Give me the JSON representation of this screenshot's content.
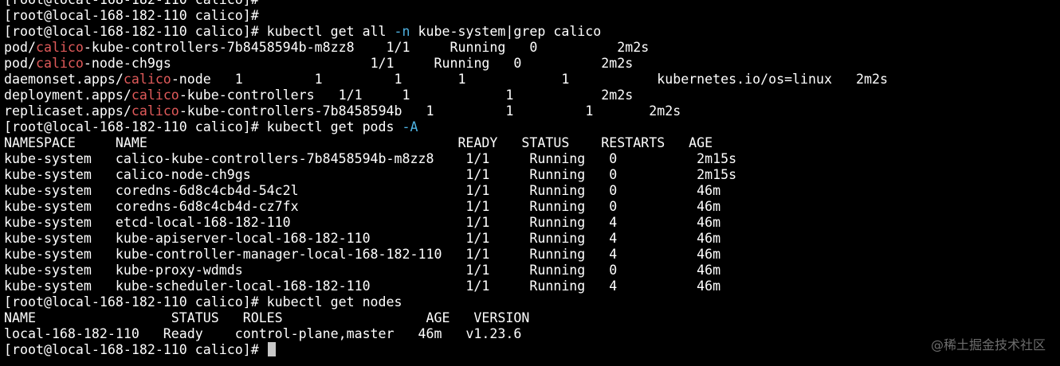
{
  "colors": {
    "background": "#000000",
    "text": "#ffffff",
    "match_highlight": "#e05a5a",
    "flag_highlight": "#4fb3e3",
    "cursor": "#c8c8c8",
    "watermark": "#6d6d6d"
  },
  "highlight_word": "calico",
  "terminal": {
    "lines": [
      {
        "segments": [
          {
            "text": "[root@local-168-182-110 calico]#"
          }
        ]
      },
      {
        "segments": [
          {
            "text": "[root@local-168-182-110 calico]#"
          }
        ]
      },
      {
        "segments": [
          {
            "text": "[root@local-168-182-110 calico]# kubectl get all "
          },
          {
            "text": "-n",
            "style": "flag"
          },
          {
            "text": " kube-system|grep calico"
          }
        ]
      },
      {
        "segments": [
          {
            "text": "pod/"
          },
          {
            "text": "calico",
            "style": "hl"
          },
          {
            "text": "-kube-controllers-7b8458594b-m8zz8    1/1     Running   0          2m2s"
          }
        ]
      },
      {
        "segments": [
          {
            "text": "pod/"
          },
          {
            "text": "calico",
            "style": "hl"
          },
          {
            "text": "-node-ch9gs                         1/1     Running   0          2m2s"
          }
        ]
      },
      {
        "segments": [
          {
            "text": "daemonset.apps/"
          },
          {
            "text": "calico",
            "style": "hl"
          },
          {
            "text": "-node   1         1         1       1            1           kubernetes.io/os=linux   2m2s"
          }
        ]
      },
      {
        "segments": [
          {
            "text": "deployment.apps/"
          },
          {
            "text": "calico",
            "style": "hl"
          },
          {
            "text": "-kube-controllers   1/1     1            1           2m2s"
          }
        ]
      },
      {
        "segments": [
          {
            "text": "replicaset.apps/"
          },
          {
            "text": "calico",
            "style": "hl"
          },
          {
            "text": "-kube-controllers-7b8458594b   1         1         1       2m2s"
          }
        ]
      },
      {
        "segments": [
          {
            "text": "[root@local-168-182-110 calico]# kubectl get pods "
          },
          {
            "text": "-A",
            "style": "flag"
          }
        ]
      },
      {
        "segments": [
          {
            "text": "NAMESPACE     NAME                                       READY   STATUS    RESTARTS   AGE"
          }
        ]
      },
      {
        "segments": [
          {
            "text": "kube-system   calico-kube-controllers-7b8458594b-m8zz8    1/1     Running   0          2m15s"
          }
        ]
      },
      {
        "segments": [
          {
            "text": "kube-system   calico-node-ch9gs                           1/1     Running   0          2m15s"
          }
        ]
      },
      {
        "segments": [
          {
            "text": "kube-system   coredns-6d8c4cb4d-54c2l                     1/1     Running   0          46m"
          }
        ]
      },
      {
        "segments": [
          {
            "text": "kube-system   coredns-6d8c4cb4d-cz7fx                     1/1     Running   0          46m"
          }
        ]
      },
      {
        "segments": [
          {
            "text": "kube-system   etcd-local-168-182-110                      1/1     Running   4          46m"
          }
        ]
      },
      {
        "segments": [
          {
            "text": "kube-system   kube-apiserver-local-168-182-110            1/1     Running   4          46m"
          }
        ]
      },
      {
        "segments": [
          {
            "text": "kube-system   kube-controller-manager-local-168-182-110   1/1     Running   4          46m"
          }
        ]
      },
      {
        "segments": [
          {
            "text": "kube-system   kube-proxy-wdmds                            1/1     Running   0          46m"
          }
        ]
      },
      {
        "segments": [
          {
            "text": "kube-system   kube-scheduler-local-168-182-110            1/1     Running   4          46m"
          }
        ]
      },
      {
        "segments": [
          {
            "text": "[root@local-168-182-110 calico]# kubectl get nodes"
          }
        ]
      },
      {
        "segments": [
          {
            "text": "NAME                 STATUS   ROLES                  AGE   VERSION"
          }
        ]
      },
      {
        "segments": [
          {
            "text": "local-168-182-110   Ready    control-plane,master   46m   v1.23.6"
          }
        ]
      },
      {
        "segments": [
          {
            "text": "[root@local-168-182-110 calico]# "
          }
        ],
        "cursor": true
      }
    ]
  },
  "watermark": {
    "text": "@稀土掘金技术社区"
  }
}
